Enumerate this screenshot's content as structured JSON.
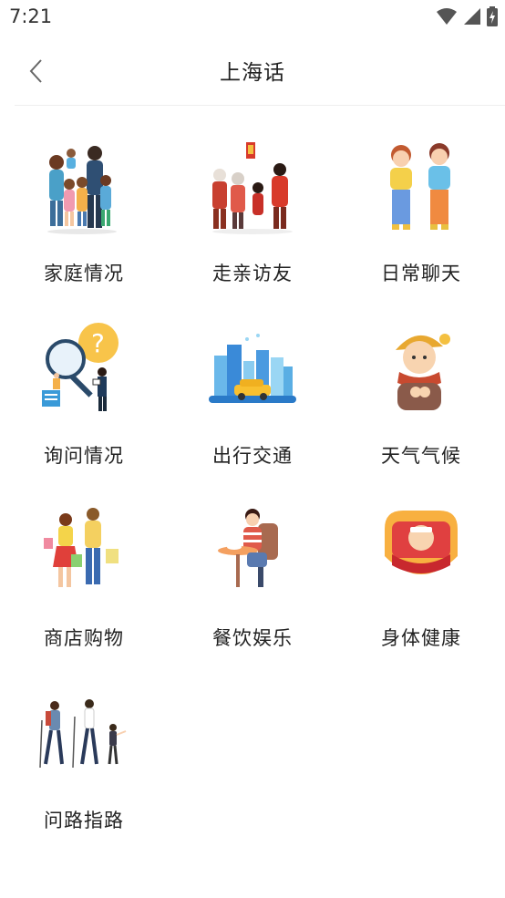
{
  "status_bar": {
    "time": "7:21"
  },
  "header": {
    "title": "上海话"
  },
  "categories": [
    {
      "label": "家庭情况",
      "icon": "family-illustration-icon"
    },
    {
      "label": "走亲访友",
      "icon": "visiting-relatives-illustration-icon"
    },
    {
      "label": "日常聊天",
      "icon": "daily-chat-illustration-icon"
    },
    {
      "label": "询问情况",
      "icon": "inquiry-illustration-icon"
    },
    {
      "label": "出行交通",
      "icon": "transport-illustration-icon"
    },
    {
      "label": "天气气候",
      "icon": "weather-illustration-icon"
    },
    {
      "label": "商店购物",
      "icon": "shopping-illustration-icon"
    },
    {
      "label": "餐饮娱乐",
      "icon": "dining-illustration-icon"
    },
    {
      "label": "身体健康",
      "icon": "health-illustration-icon"
    },
    {
      "label": "问路指路",
      "icon": "directions-illustration-icon"
    }
  ]
}
